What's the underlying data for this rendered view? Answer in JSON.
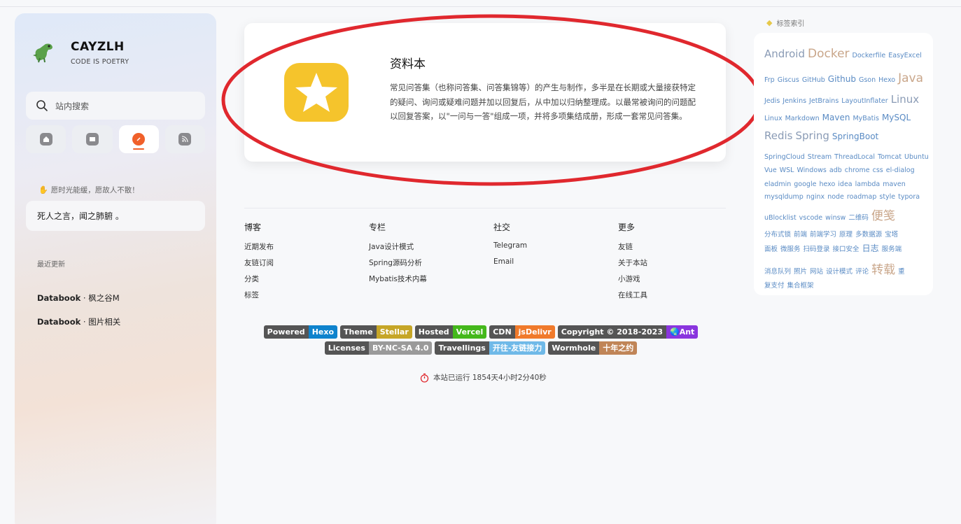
{
  "site": {
    "title": "CAYZLH",
    "subtitle": "CODE IS POETRY"
  },
  "search": {
    "placeholder": "站内搜索"
  },
  "nav_tabs": [
    {
      "icon": "home-icon",
      "active": false
    },
    {
      "icon": "wiki-icon",
      "active": false
    },
    {
      "icon": "explore-icon",
      "active": true
    },
    {
      "icon": "rss-icon",
      "active": false
    }
  ],
  "quote": {
    "heading": "愿时光能缓，愿故人不散！",
    "text": "死人之言，闻之肺腑 。"
  },
  "recent": {
    "heading": "最近更新",
    "items": [
      {
        "prefix": "Databook",
        "sep": " · ",
        "title": "枫之谷M"
      },
      {
        "prefix": "Databook",
        "sep": " · ",
        "title": "图片相关"
      }
    ]
  },
  "card": {
    "title": "资料本",
    "description": "常见问答集（也称问答集、问答集锦等）的产生与制作，多半是在长期或大量接获特定的疑问、询问或疑难问题并加以回复后，从中加以归纳整理成。以最常被询问的问题配以回复答案，以\"一问与一答\"组成一项，并将多项集结成册，形成一套常见问答集。"
  },
  "footer": {
    "columns": [
      {
        "title": "博客",
        "links": [
          "近期发布",
          "友链订阅",
          "分类",
          "标签"
        ]
      },
      {
        "title": "专栏",
        "links": [
          "Java设计模式",
          "Spring源码分析",
          "Mybatis技术内幕"
        ]
      },
      {
        "title": "社交",
        "links": [
          "Telegram",
          "Email"
        ]
      },
      {
        "title": "更多",
        "links": [
          "友链",
          "关于本站",
          "小游戏",
          "在线工具"
        ]
      }
    ],
    "badges_row1": [
      {
        "label": "Powered",
        "value": "Hexo",
        "color": "#0e83cd"
      },
      {
        "label": "Theme",
        "value": "Stellar",
        "color": "#c6a627"
      },
      {
        "label": "Hosted",
        "value": "Vercel",
        "color": "#44b81b"
      },
      {
        "label": "CDN",
        "value": "jsDelivr",
        "color": "#f07a2b"
      },
      {
        "label": "Copyright © 2018-2023",
        "value": "🌏Ant",
        "color": "#8a35de"
      }
    ],
    "badges_row2": [
      {
        "label": "Licenses",
        "value": "BY-NC-SA 4.0",
        "color": "#9a9a9a"
      },
      {
        "label": "Travellings",
        "value": "开往-友链接力",
        "color": "#6fb9e8"
      },
      {
        "label": "Wormhole",
        "value": "十年之约",
        "color": "#c08557"
      }
    ],
    "runtime": "本站已运行 1854天4小时2分40秒"
  },
  "tags": {
    "heading": "标签索引",
    "lines": [
      [
        {
          "t": "Android",
          "s": "l"
        },
        {
          "t": "Docker",
          "s": "xl"
        },
        {
          "t": "Dockerfile",
          "s": "s"
        },
        {
          "t": "EasyExcel",
          "s": "s"
        }
      ],
      [
        {
          "t": "Frp",
          "s": "s"
        },
        {
          "t": "Giscus",
          "s": "s"
        },
        {
          "t": "GitHub",
          "s": "s"
        },
        {
          "t": "Github",
          "s": "m"
        },
        {
          "t": "Gson",
          "s": "s"
        },
        {
          "t": "Hexo",
          "s": "s"
        },
        {
          "t": "Java",
          "s": "xl"
        }
      ],
      [
        {
          "t": "Jedis",
          "s": "s"
        },
        {
          "t": "Jenkins",
          "s": "s"
        },
        {
          "t": "JetBrains",
          "s": "s"
        },
        {
          "t": "LayoutInflater",
          "s": "s"
        },
        {
          "t": "Linux",
          "s": "l"
        }
      ],
      [
        {
          "t": "Linux",
          "s": "s"
        },
        {
          "t": "Markdown",
          "s": "s"
        },
        {
          "t": "Maven",
          "s": "m"
        },
        {
          "t": "MyBatis",
          "s": "s"
        },
        {
          "t": "MySQL",
          "s": "m"
        }
      ],
      [
        {
          "t": "Redis",
          "s": "l"
        },
        {
          "t": "Spring",
          "s": "l"
        },
        {
          "t": "SpringBoot",
          "s": "m"
        }
      ],
      [
        {
          "t": "SpringCloud",
          "s": "s"
        },
        {
          "t": "Stream",
          "s": "s"
        },
        {
          "t": "ThreadLocal",
          "s": "s"
        },
        {
          "t": "Tomcat",
          "s": "s"
        },
        {
          "t": "Ubuntu",
          "s": "s"
        }
      ],
      [
        {
          "t": "Vue",
          "s": "s"
        },
        {
          "t": "WSL",
          "s": "s"
        },
        {
          "t": "Windows",
          "s": "s"
        },
        {
          "t": "adb",
          "s": "s"
        },
        {
          "t": "chrome",
          "s": "s"
        },
        {
          "t": "css",
          "s": "s"
        },
        {
          "t": "el-dialog",
          "s": "s"
        }
      ],
      [
        {
          "t": "eladmin",
          "s": "s"
        },
        {
          "t": "google",
          "s": "s"
        },
        {
          "t": "hexo",
          "s": "s"
        },
        {
          "t": "idea",
          "s": "s"
        },
        {
          "t": "lambda",
          "s": "s"
        },
        {
          "t": "maven",
          "s": "s"
        }
      ],
      [
        {
          "t": "mysqldump",
          "s": "s"
        },
        {
          "t": "nginx",
          "s": "s"
        },
        {
          "t": "node",
          "s": "s"
        },
        {
          "t": "roadmap",
          "s": "s"
        },
        {
          "t": "style",
          "s": "s"
        },
        {
          "t": "typora",
          "s": "s"
        }
      ],
      [
        {
          "t": "uBlocklist",
          "s": "s"
        },
        {
          "t": "vscode",
          "s": "s"
        },
        {
          "t": "winsw",
          "s": "s"
        },
        {
          "t": "二维码",
          "s": "s"
        },
        {
          "t": "便笺",
          "s": "xl"
        }
      ],
      [
        {
          "t": "分布式锁",
          "s": "s"
        },
        {
          "t": "前端",
          "s": "s"
        },
        {
          "t": "前端学习",
          "s": "s"
        },
        {
          "t": "原理",
          "s": "s"
        },
        {
          "t": "多数据源",
          "s": "s"
        },
        {
          "t": "宝塔",
          "s": "s"
        }
      ],
      [
        {
          "t": "面板",
          "s": "s"
        },
        {
          "t": "微服务",
          "s": "s"
        },
        {
          "t": "扫码登录",
          "s": "s"
        },
        {
          "t": "接口安全",
          "s": "s"
        },
        {
          "t": "日志",
          "s": "m"
        },
        {
          "t": "服务端",
          "s": "s"
        }
      ],
      [
        {
          "t": "消息队列",
          "s": "s"
        },
        {
          "t": "照片",
          "s": "s"
        },
        {
          "t": "网站",
          "s": "s"
        },
        {
          "t": "设计模式",
          "s": "s"
        },
        {
          "t": "评论",
          "s": "s"
        },
        {
          "t": "转载",
          "s": "xl"
        },
        {
          "t": "重",
          "s": "s"
        }
      ],
      [
        {
          "t": "复支付",
          "s": "s"
        },
        {
          "t": "集合框架",
          "s": "s"
        }
      ]
    ]
  },
  "colors": {
    "accent": "#f0602a",
    "card_icon": "#f5c42c",
    "annotation": "#e0282e",
    "tag": "#5a8bc4"
  }
}
